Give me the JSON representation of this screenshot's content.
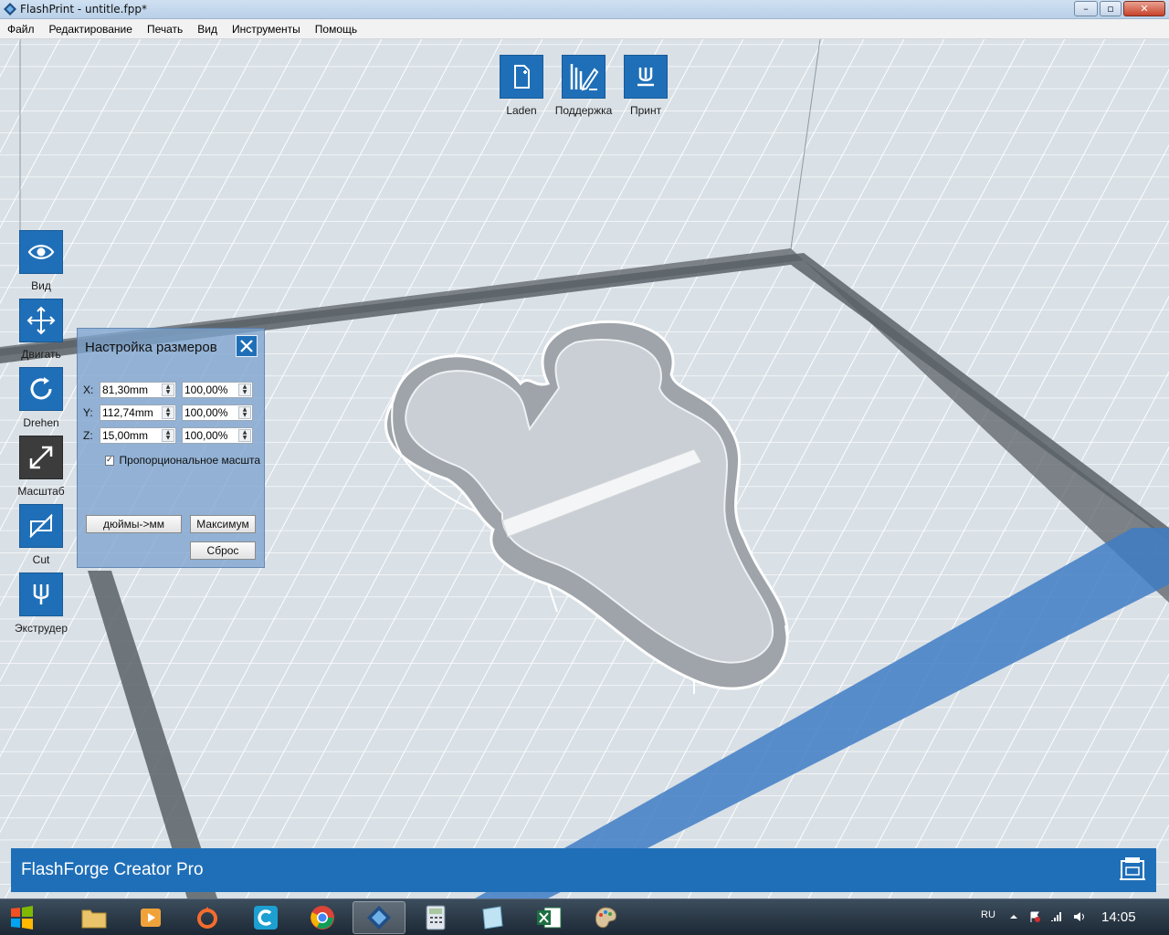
{
  "window": {
    "title": "FlashPrint - untitle.fpp*",
    "minimize": "–",
    "maximize": "▫",
    "close": "✕"
  },
  "menu": {
    "items": [
      "Файл",
      "Редактирование",
      "Печать",
      "Вид",
      "Инструменты",
      "Помощь"
    ]
  },
  "top_toolbar": [
    {
      "label": "Laden",
      "icon": "file-add-icon"
    },
    {
      "label": "Поддержка",
      "icon": "support-edit-icon"
    },
    {
      "label": "Принт",
      "icon": "print-icon"
    }
  ],
  "left_toolbar": [
    {
      "label": "Вид",
      "icon": "eye-icon"
    },
    {
      "label": "Двигать",
      "icon": "move-arrows-icon"
    },
    {
      "label": "Drehen",
      "icon": "rotate-icon"
    },
    {
      "label": "Масштаб",
      "icon": "scale-icon",
      "active": true
    },
    {
      "label": "Cut",
      "icon": "cut-icon"
    },
    {
      "label": "Экструдер",
      "icon": "extruder-icon"
    }
  ],
  "scale_panel": {
    "title": "Настройка размеров",
    "rows": [
      {
        "axis": "X:",
        "size": "81,30mm",
        "percent": "100,00%"
      },
      {
        "axis": "Y:",
        "size": "112,74mm",
        "percent": "100,00%"
      },
      {
        "axis": "Z:",
        "size": "15,00mm",
        "percent": "100,00%"
      }
    ],
    "proportional_label": "Пропорциональное масштабирование",
    "proportional_checked": "✓",
    "inch_to_mm_button": "дюймы->мм",
    "max_button": "Максимум",
    "reset_button": "Сброс"
  },
  "status_bar": {
    "printer_name": "FlashForge Creator Pro"
  },
  "taskbar": {
    "language": "RU",
    "clock": "14:05"
  },
  "colors": {
    "accent": "#1f6fb8",
    "status_bar": "#1f6fb8",
    "plate": "#d7dee4",
    "model": "#e6e6e6"
  }
}
